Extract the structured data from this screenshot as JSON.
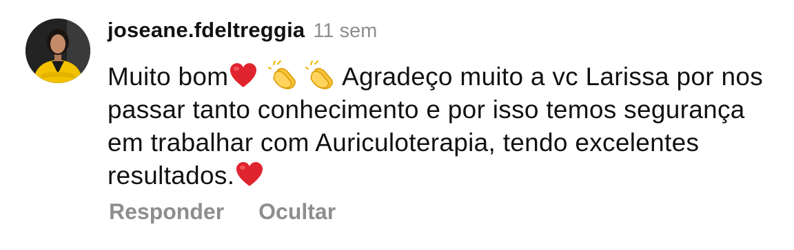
{
  "comment": {
    "username": "joseane.fdeltreggia",
    "timestamp": "11 sem",
    "text_part1": "Muito bom",
    "text_part2": " Agradeço muito a vc Larissa por nos passar tanto conhecimento e por isso temos segurança em trabalhar com Auriculoterapia, tendo excelentes resultados.",
    "emojis": [
      "red-heart",
      "clapping-hands",
      "clapping-hands",
      "red-heart"
    ],
    "avatar": "profile-photo-woman-yellow-blazer"
  },
  "actions": {
    "reply_label": "Responder",
    "hide_label": "Ocultar"
  },
  "colors": {
    "text": "#111111",
    "muted": "#8e8e8e",
    "heart": "#e0242f",
    "clap": "#f7c23b",
    "blazer": "#f2c200"
  }
}
